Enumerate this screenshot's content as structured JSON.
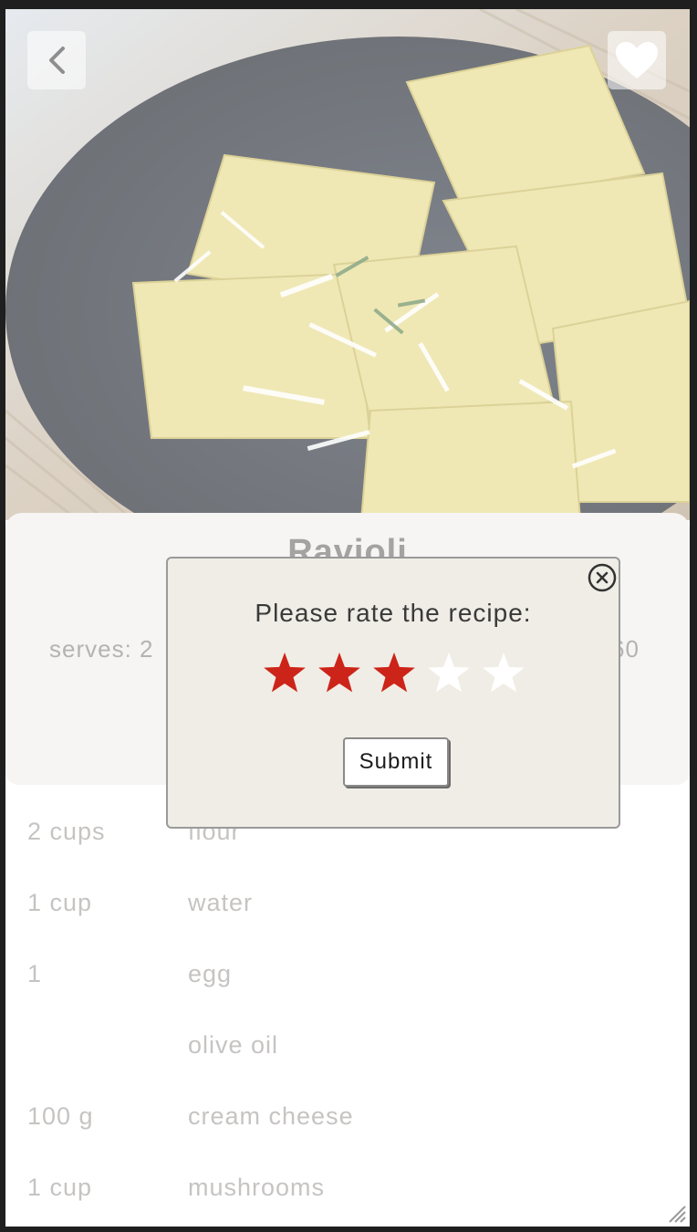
{
  "header": {
    "back_icon": "chevron-left-icon",
    "favorite_icon": "heart-icon"
  },
  "recipe": {
    "title": "Ravioli",
    "serves_label": "serves: 2",
    "right_meta": "60"
  },
  "ingredients": [
    {
      "qty": "2 cups",
      "name": "flour"
    },
    {
      "qty": "1 cup",
      "name": "water"
    },
    {
      "qty": "1",
      "name": "egg"
    },
    {
      "qty": "",
      "name": "olive oil"
    },
    {
      "qty": "100 g",
      "name": "cream cheese"
    },
    {
      "qty": "1 cup",
      "name": "mushrooms"
    }
  ],
  "rating_modal": {
    "prompt": "Please rate the recipe:",
    "rating": 3,
    "max_rating": 5,
    "submit_label": "Submit",
    "close_icon": "close-circle-icon",
    "star_icon": "star-icon"
  },
  "colors": {
    "star_filled": "#cc2419",
    "star_empty": "#ffffff",
    "modal_bg": "#f0ede6"
  }
}
